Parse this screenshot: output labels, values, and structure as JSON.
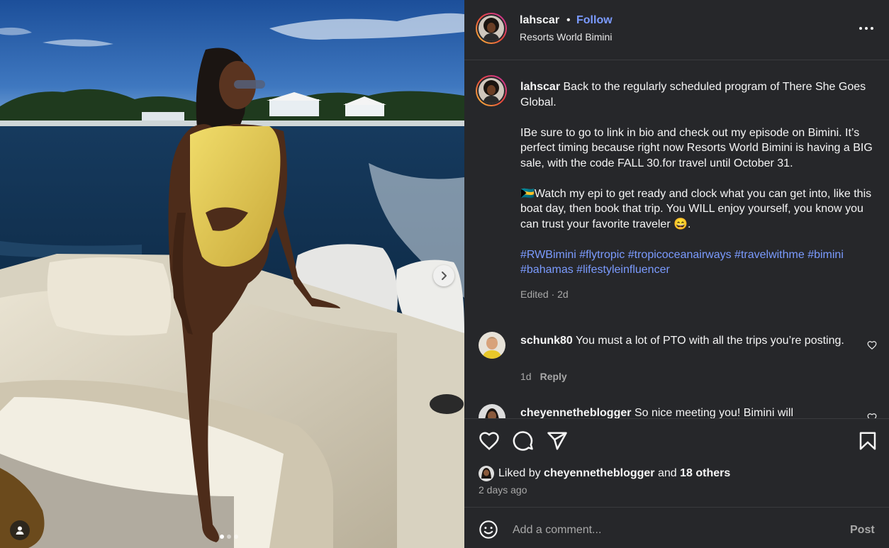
{
  "post": {
    "username": "lahscar",
    "follow_label": "Follow",
    "dot": "•",
    "location": "Resorts World Bimini"
  },
  "caption": {
    "username": "lahscar",
    "line1": "Back to the regularly scheduled program of There She Goes Global.",
    "line2": "IBe sure to go to link in bio and check out my episode on Bimini. It’s perfect timing because right now Resorts World Bimini is having a BIG sale, with the code FALL 30.for travel until October 31.",
    "line3_flag": "🇧🇸",
    "line3": "Watch my epi to get ready and clock what you can get into, like this boat day, then book that trip. You WILL enjoy yourself, you know you can trust your favorite traveler",
    "line3_emoji": "😄",
    "line3_end": ".",
    "hashtags": "#RWBimini #flytropic #tropicoceanairways #travelwithme #bimini #bahamas #lifestyleinfluencer",
    "meta": "Edited · 2d"
  },
  "comments": [
    {
      "username": "schunk80",
      "text": "You must a lot of PTO with all the trips you’re posting.",
      "time": "1d",
      "reply_label": "Reply"
    },
    {
      "username": "cheyennetheblogger",
      "text": "So nice meeting you! Bimini will"
    }
  ],
  "likes": {
    "prefix": "Liked by",
    "user": "cheyennetheblogger",
    "and": "and",
    "others": "18 others",
    "time_ago": "2 days ago"
  },
  "comment_box": {
    "placeholder": "Add a comment...",
    "post_label": "Post"
  },
  "carousel": {
    "current": 1,
    "total": 3
  },
  "colors": {
    "panel_bg": "#26272a",
    "link_blue": "#7b9bff",
    "muted": "#a8a8a8"
  },
  "icons": [
    "more-options-icon",
    "heart-icon",
    "comment-icon",
    "share-icon",
    "bookmark-icon",
    "emoji-icon",
    "chevron-right-icon",
    "user-tag-icon"
  ]
}
